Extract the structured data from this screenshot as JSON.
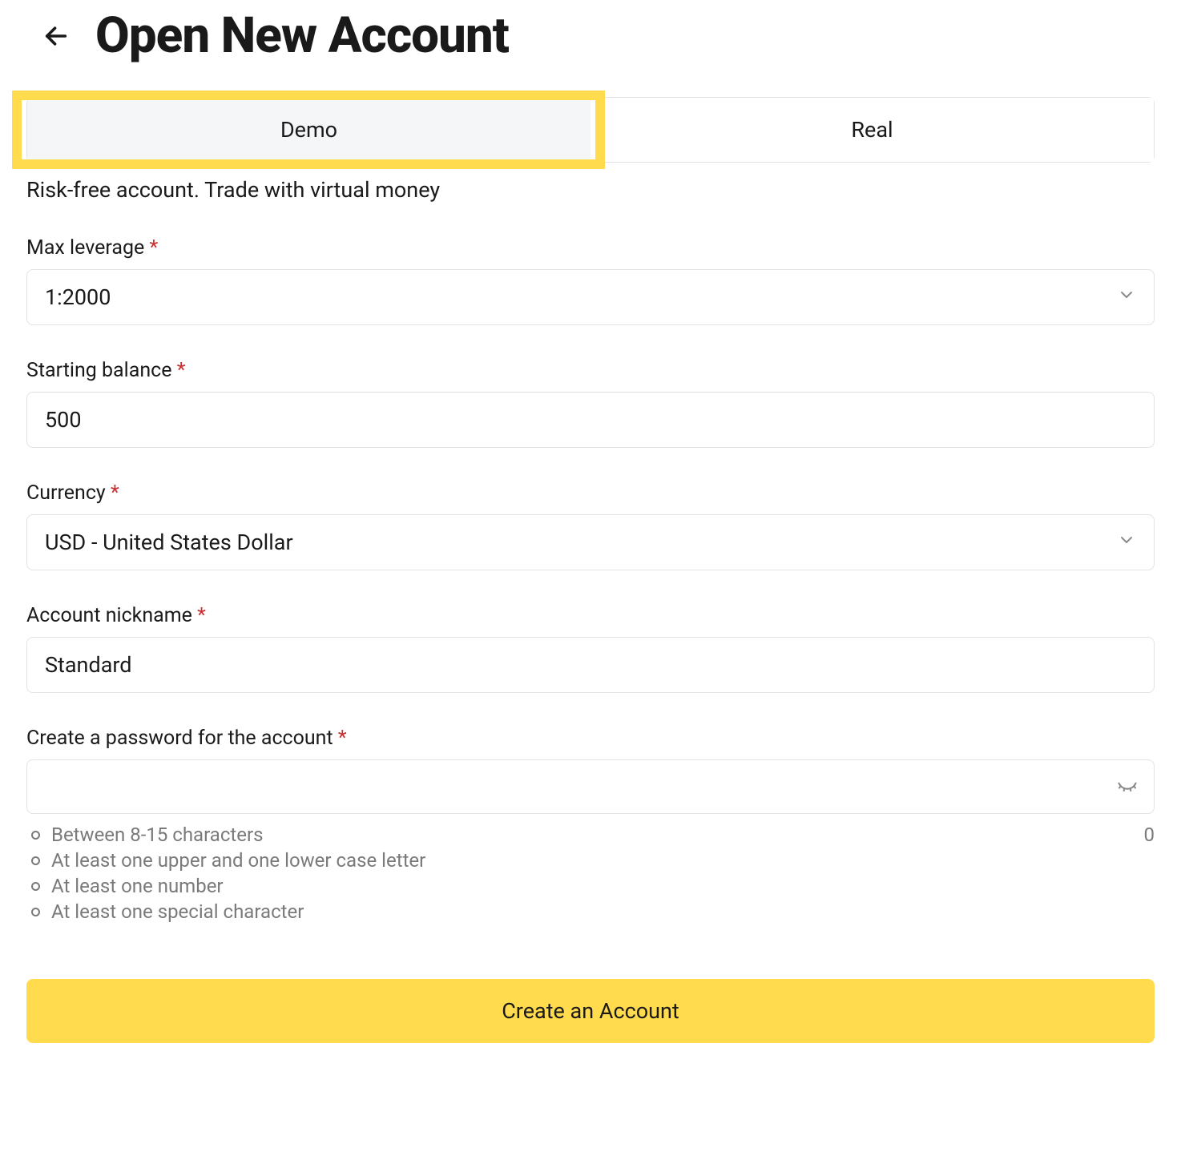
{
  "header": {
    "title": "Open New Account"
  },
  "tabs": {
    "demo": "Demo",
    "real": "Real",
    "description": "Risk-free account. Trade with virtual money"
  },
  "form": {
    "leverage": {
      "label": "Max leverage",
      "value": "1:2000"
    },
    "balance": {
      "label": "Starting balance",
      "value": "500"
    },
    "currency": {
      "label": "Currency",
      "value": "USD - United States Dollar"
    },
    "nickname": {
      "label": "Account nickname",
      "value": "Standard"
    },
    "password": {
      "label": "Create a password for the account",
      "value": "",
      "char_count": "0",
      "hints": [
        "Between 8-15 characters",
        "At least one upper and one lower case letter",
        "At least one number",
        "At least one special character"
      ]
    },
    "submit": "Create an Account"
  },
  "required_marker": "*"
}
